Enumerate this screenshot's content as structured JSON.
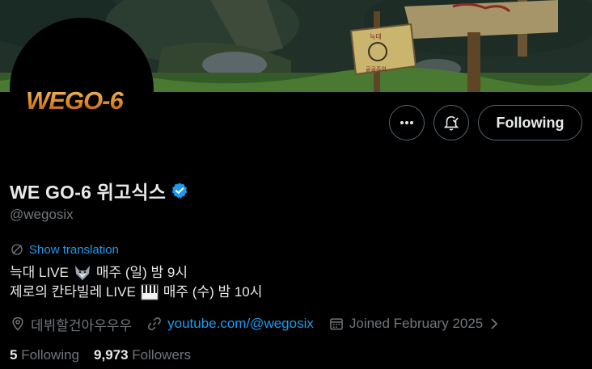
{
  "profile": {
    "display_name": "WE GO-6 위고식스",
    "handle": "@wegosix",
    "avatar_logo_text": "WEGO-6",
    "verified": true
  },
  "banner": {
    "sign_text_top": "늑대",
    "sign_text_bottom": "골골주의"
  },
  "actions": {
    "more_icon": "more-horizontal-icon",
    "notify_icon": "bell-check-icon",
    "follow_label": "Following"
  },
  "translation": {
    "label": "Show translation"
  },
  "bio": {
    "line1_text": "늑대 LIVE",
    "line1_emoji": "wolf-emoji",
    "line1_rest": "매주 (일) 밤 9시",
    "line2_text": "제로의 칸타빌레 LIVE",
    "line2_emoji": "piano-emoji",
    "line2_rest": "매주 (수) 밤 10시"
  },
  "meta": {
    "location": "데뷔할건아우우우",
    "link": "youtube.com/@wegosix",
    "joined": "Joined February 2025"
  },
  "stats": {
    "following_count": "5",
    "following_label": "Following",
    "followers_count": "9,973",
    "followers_label": "Followers"
  },
  "colors": {
    "accent": "#1d9bf0",
    "muted": "#71767b",
    "text": "#e7e9ea",
    "border": "#536471"
  }
}
